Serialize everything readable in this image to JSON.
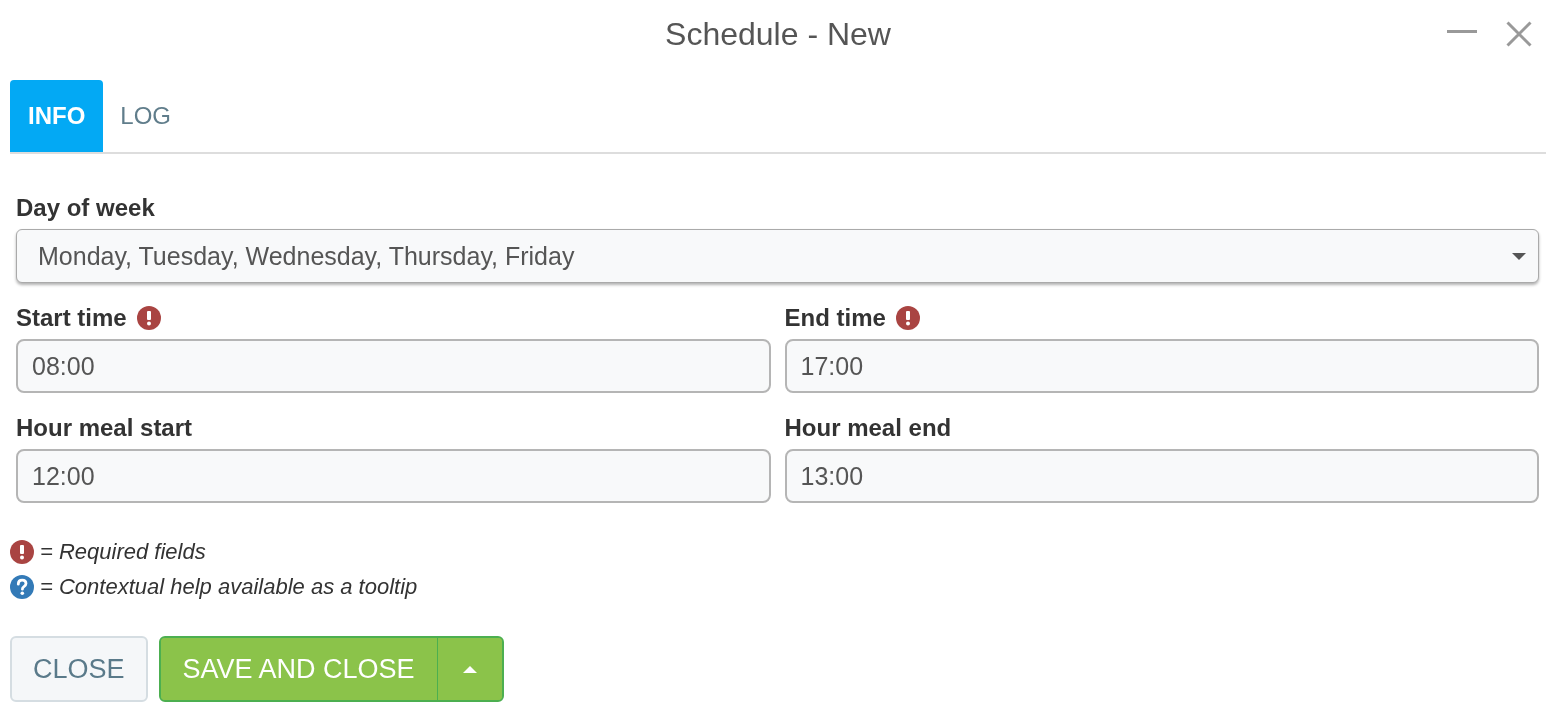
{
  "window": {
    "title": "Schedule - New"
  },
  "tabs": [
    {
      "label": "INFO",
      "selected": true
    },
    {
      "label": "LOG",
      "selected": false
    }
  ],
  "day_of_week": {
    "label": "Day of week",
    "value": "Monday, Tuesday, Wednesday, Thursday, Friday"
  },
  "fields": [
    {
      "label": "Start time",
      "required": true,
      "value": "08:00"
    },
    {
      "label": "End time",
      "required": true,
      "value": "17:00"
    },
    {
      "label": "Hour meal start",
      "required": false,
      "value": "12:00"
    },
    {
      "label": "Hour meal end",
      "required": false,
      "value": "13:00"
    }
  ],
  "legend": [
    {
      "kind": "required",
      "text": "= Required fields"
    },
    {
      "kind": "help",
      "text": "= Contextual help available as a tooltip"
    }
  ],
  "buttons": [
    {
      "kind": "plain",
      "label": "CLOSE"
    },
    {
      "kind": "split",
      "label": "SAVE AND CLOSE"
    }
  ]
}
